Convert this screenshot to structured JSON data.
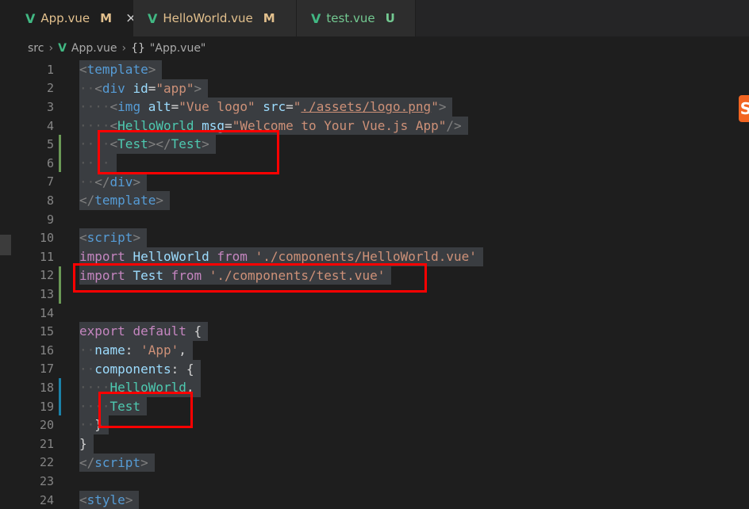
{
  "tabs": [
    {
      "icon": "vue-icon",
      "name": "App.vue",
      "flag": "M",
      "active": true,
      "close": "×"
    },
    {
      "icon": "vue-icon",
      "name": "HelloWorld.vue",
      "flag": "M",
      "active": false
    },
    {
      "icon": "vue-icon",
      "name": "test.vue",
      "flag": "U",
      "active": false
    }
  ],
  "breadcrumb": {
    "folder": "src",
    "file": "App.vue",
    "symbol_icon": "{}",
    "symbol": "\"App.vue\""
  },
  "colors": {
    "highlight_box": "#ff0000",
    "git_modified": "#6a9955",
    "git_changed": "#1b81a8",
    "vue": "#41b883"
  },
  "lines": [
    {
      "num": "1"
    },
    {
      "num": "2"
    },
    {
      "num": "3"
    },
    {
      "num": "4"
    },
    {
      "num": "5"
    },
    {
      "num": "6"
    },
    {
      "num": "7"
    },
    {
      "num": "8"
    },
    {
      "num": "9"
    },
    {
      "num": "10"
    },
    {
      "num": "11"
    },
    {
      "num": "12"
    },
    {
      "num": "13"
    },
    {
      "num": "14"
    },
    {
      "num": "15"
    },
    {
      "num": "16"
    },
    {
      "num": "17"
    },
    {
      "num": "18"
    },
    {
      "num": "19"
    },
    {
      "num": "20"
    },
    {
      "num": "21"
    },
    {
      "num": "22"
    },
    {
      "num": "23"
    },
    {
      "num": "24"
    }
  ],
  "code": {
    "l1": {
      "open": "<",
      "tag": "template",
      "close": ">"
    },
    "l2": {
      "open": "<",
      "tag": "div",
      "attr": "id",
      "eq": "=",
      "val": "\"app\"",
      "close": ">"
    },
    "l3": {
      "open": "<",
      "tag": "img",
      "attr1": "alt",
      "val1": "\"Vue logo\"",
      "attr2": "src",
      "val2q1": "\"",
      "val2": "./assets/logo.png",
      "val2q2": "\"",
      "close": ">"
    },
    "l4": {
      "open": "<",
      "tag": "HelloWorld",
      "attr": "msg",
      "val": "\"Welcome to Your Vue.js App\"",
      "close": "/>"
    },
    "l5": {
      "open": "<",
      "tag": "Test",
      "mid": "></",
      "tag2": "Test",
      "close": ">"
    },
    "l7": {
      "open": "</",
      "tag": "div",
      "close": ">"
    },
    "l8": {
      "open": "</",
      "tag": "template",
      "close": ">"
    },
    "l10": {
      "open": "<",
      "tag": "script",
      "close": ">"
    },
    "l11": {
      "kw": "import",
      "name": "HelloWorld",
      "from": "from",
      "path": "'./components/HelloWorld.vue'"
    },
    "l12": {
      "kw": "import",
      "name": "Test",
      "from": "from",
      "path": "'./components/test.vue'"
    },
    "l15": {
      "kw1": "export",
      "kw2": "default",
      "brace": "{"
    },
    "l16": {
      "key": "name",
      "colon": ":",
      "val": "'App'",
      "comma": ","
    },
    "l17": {
      "key": "components",
      "colon": ":",
      "brace": "{"
    },
    "l18": {
      "name": "HelloWorld",
      "comma": ","
    },
    "l19": {
      "name": "Test"
    },
    "l20": {
      "brace": "}"
    },
    "l21": {
      "brace": "}"
    },
    "l22": {
      "open": "</",
      "tag": "script",
      "close": ">"
    },
    "l24": {
      "open": "<",
      "tag": "style",
      "close": ">"
    }
  },
  "floating_badge": "S"
}
